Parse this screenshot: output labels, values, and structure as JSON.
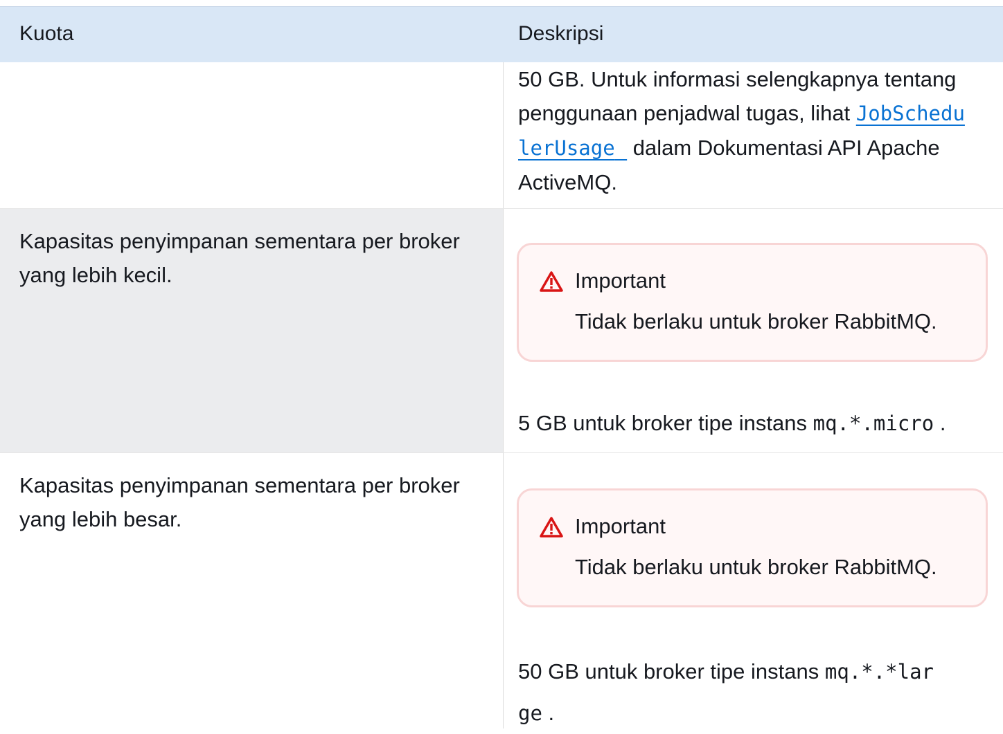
{
  "table": {
    "headers": {
      "quota": "Kuota",
      "description": "Deskripsi"
    },
    "rows": [
      {
        "quota": "",
        "description": {
          "prefix": "50 GB. Untuk informasi selengkapnya tentang penggunaan penjadwal tugas, lihat ",
          "link_line1": "JobSchedu",
          "link_line2": "lerUsage",
          "suffix": " dalam Dokumentasi API Apache ActiveMQ."
        }
      },
      {
        "quota": "Kapasitas penyimpanan sementara per broker yang lebih kecil.",
        "alert": {
          "icon": "warning-icon",
          "title": "Important",
          "body": "Tidak berlaku untuk broker RabbitMQ."
        },
        "capacity": {
          "prefix": "5 GB untuk broker tipe instans ",
          "code": "mq.*.micro",
          "suffix": " ."
        }
      },
      {
        "quota": "Kapasitas penyimpanan sementara per broker yang lebih besar.",
        "alert": {
          "icon": "warning-icon",
          "title": "Important",
          "body": "Tidak berlaku untuk broker RabbitMQ."
        },
        "capacity": {
          "prefix": "50 GB untuk broker tipe instans ",
          "code_line1": "mq.*.*lar",
          "code_line2": "ge",
          "suffix": " ."
        }
      }
    ]
  },
  "colors": {
    "header_bg": "#d9e7f6",
    "row_alt_bg": "#ebecee",
    "link": "#0972d3",
    "alert_bg": "#fff7f7",
    "alert_border": "#f8d5d5",
    "alert_icon": "#d91515"
  }
}
